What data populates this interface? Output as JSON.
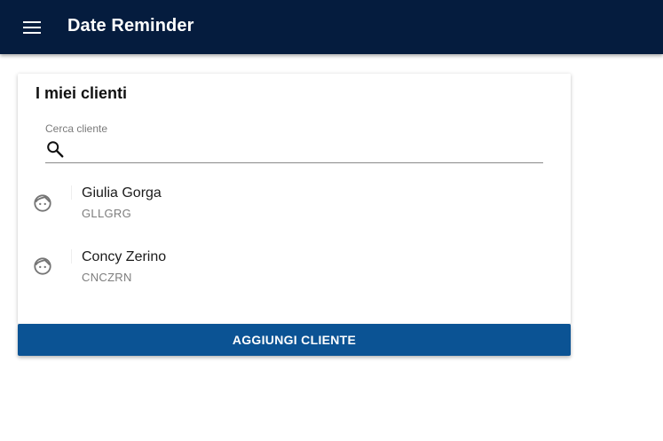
{
  "appbar": {
    "title": "Date Reminder",
    "menu_icon": "menu-icon",
    "background": "#051c3e"
  },
  "card": {
    "title": "I miei clienti",
    "search": {
      "label": "Cerca cliente",
      "value": "",
      "icon": "search-icon"
    },
    "clients": [
      {
        "name": "Giulia Gorga",
        "code": "GLLGRG",
        "icon": "face-icon"
      },
      {
        "name": "Concy Zerino",
        "code": "CNCZRN",
        "icon": "face-icon"
      }
    ]
  },
  "actions": {
    "add_client_label": "AGGIUNGI CLIENTE",
    "button_color": "#0b5394"
  }
}
